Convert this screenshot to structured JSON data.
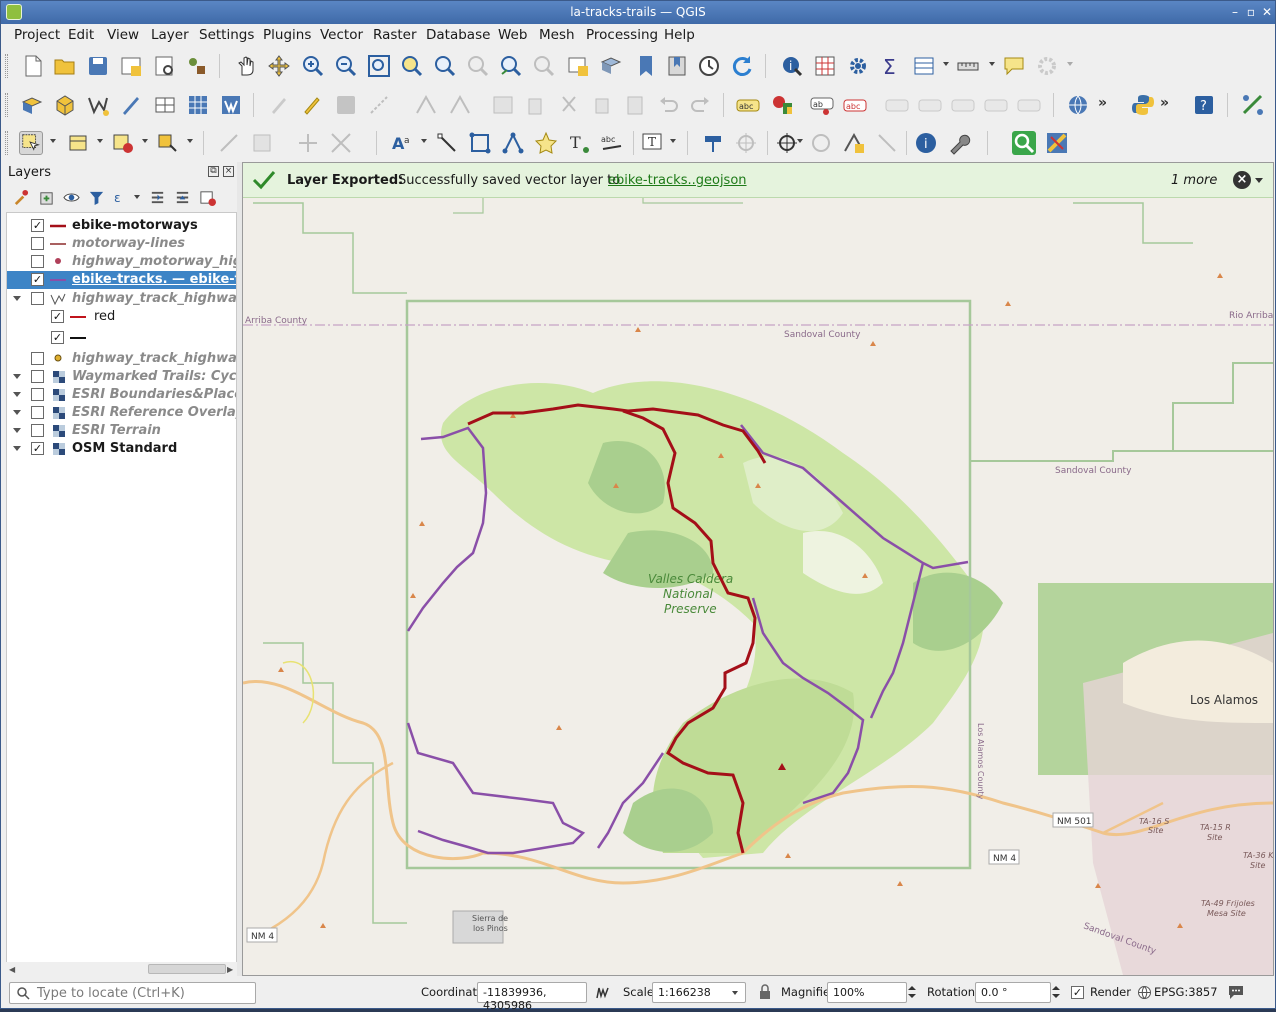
{
  "window": {
    "title": "la-tracks-trails — QGIS"
  },
  "menubar": [
    "Project",
    "Edit",
    "View",
    "Layer",
    "Settings",
    "Plugins",
    "Vector",
    "Raster",
    "Database",
    "Web",
    "Mesh",
    "Processing",
    "Help"
  ],
  "layers_panel": {
    "title": "Layers",
    "layers": [
      {
        "label": "ebike-motorways",
        "checked": true,
        "style": "bold",
        "symbol": "line-red"
      },
      {
        "label": "motorway-lines",
        "checked": false,
        "style": "dim",
        "symbol": "line-darkred"
      },
      {
        "label": "highway_motorway_highway_trunk",
        "checked": false,
        "style": "dim",
        "symbol": "point-red"
      },
      {
        "label": "ebike-tracks. — ebike-tracks",
        "checked": true,
        "style": "selected",
        "symbol": "line-purple"
      },
      {
        "label": "highway_track_highway_path",
        "checked": false,
        "style": "dim",
        "symbol": "rule-based",
        "expanded": true
      },
      {
        "label": "red",
        "checked": true,
        "style": "normal",
        "symbol": "line-red",
        "child": true
      },
      {
        "label": "",
        "checked": true,
        "style": "normal",
        "symbol": "line-black",
        "child": true
      },
      {
        "label": "highway_track_highway_path",
        "checked": false,
        "style": "dim",
        "symbol": "point-yellow"
      },
      {
        "label": "Waymarked Trails: Cycling",
        "checked": false,
        "style": "dim",
        "symbol": "raster",
        "expanded": false
      },
      {
        "label": "ESRI Boundaries&Places",
        "checked": false,
        "style": "dim",
        "symbol": "raster",
        "expanded": false
      },
      {
        "label": "ESRI Reference Overlay",
        "checked": false,
        "style": "dim",
        "symbol": "raster",
        "expanded": false
      },
      {
        "label": "ESRI Terrain",
        "checked": false,
        "style": "dim",
        "symbol": "raster",
        "expanded": false
      },
      {
        "label": "OSM Standard",
        "checked": true,
        "style": "bold",
        "symbol": "raster",
        "expanded": false
      }
    ]
  },
  "message_bar": {
    "title": "Layer Exported:",
    "text": "Successfully saved vector layer to",
    "link": "ebike-tracks..geojson",
    "more": "1 more"
  },
  "map_labels": {
    "arriba": "Arriba County",
    "rio_arriba": "Rio Arriba",
    "sandoval1": "Sandoval County",
    "sandoval2": "Sandoval County",
    "sandoval3": "Sandoval County",
    "valles1": "Valles Caldera",
    "valles2": "National",
    "valles3": "Preserve",
    "los_alamos": "Los Alamos",
    "los_alamos_county": "Los Alamos County",
    "nm501": "NM 501",
    "nm4a": "NM 4",
    "nm4b": "NM 4",
    "ta16a": "TA-16 S",
    "ta16b": "Site",
    "ta15a": "TA-15 R",
    "ta15b": "Site",
    "ta36a": "TA-36 K",
    "ta36b": "Site",
    "ta49a": "TA-49 Frijoles",
    "ta49b": "Mesa Site",
    "sierra1": "Sierra de",
    "sierra2": "los Pinos"
  },
  "statusbar": {
    "locator_placeholder": "Type to locate (Ctrl+K)",
    "coordinate_label": "Coordinate",
    "coordinate_value": "-11839936, 4305986",
    "scale_label": "Scale",
    "scale_value": "1:166238",
    "magnifier_label": "Magnifier",
    "magnifier_value": "100%",
    "rotation_label": "Rotation",
    "rotation_value": "0.0 °",
    "render_label": "Render",
    "render_checked": true,
    "crs": "EPSG:3857"
  },
  "colors": {
    "motorway": "#a40f18",
    "track": "#8a4fa8",
    "park": "#cde6a6",
    "park_dark": "#a8ce87",
    "selection": "#3d84c6",
    "message_bg": "#e5f3dd"
  }
}
